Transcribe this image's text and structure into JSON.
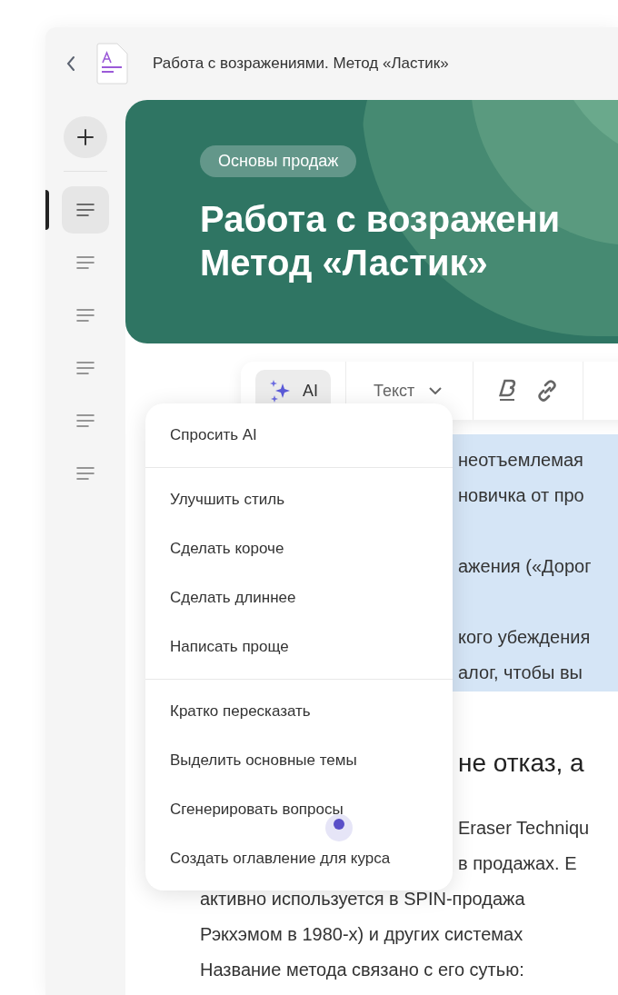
{
  "header": {
    "title": "Работа с возражениями. Метод «Ластик»"
  },
  "sidebar": {
    "pages": [
      {
        "selected": true
      },
      {
        "selected": false
      },
      {
        "selected": false
      },
      {
        "selected": false
      },
      {
        "selected": false
      },
      {
        "selected": false
      }
    ]
  },
  "hero": {
    "tag": "Основы продаж",
    "title_lines": [
      "Работа с возражени",
      "Метод «Ластик»"
    ]
  },
  "toolbar": {
    "ai_button": "AI",
    "style_dropdown": "Текст"
  },
  "ai_menu": {
    "groups": [
      [
        "Спросить AI"
      ],
      [
        "Улучшить стиль",
        "Сделать короче",
        "Сделать длиннее",
        "Написать проще"
      ],
      [
        "Кратко пересказать",
        "Выделить основные темы",
        "Сгенерировать вопросы",
        "Создать оглавление для курса"
      ]
    ]
  },
  "document": {
    "selected_paragraphs": [
      [
        "неотъемлемая",
        "новичка от про"
      ],
      [
        "ажения («Дорог"
      ],
      [
        "кого убеждения",
        "алог, чтобы вы"
      ]
    ],
    "heading_fragment": "не отказ, а",
    "partial_lines": [
      "Eraser Techniqu",
      "в продажах. Е"
    ],
    "lines": [
      "активно используется в SPIN-продажа",
      "Рэкхэмом в 1980-х) и других системах",
      "Название метода связано с его сутью:"
    ]
  }
}
